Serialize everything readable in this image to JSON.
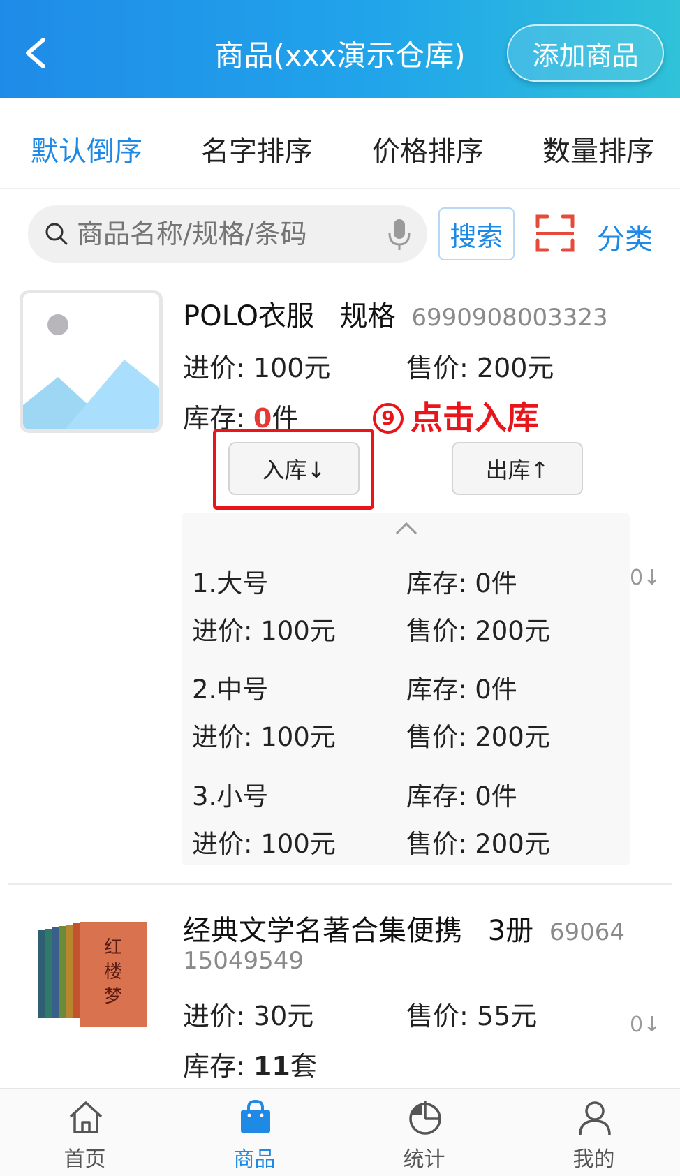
{
  "header": {
    "title": "商品(xxx演示仓库)",
    "add_button": "添加商品"
  },
  "sort_tabs": [
    "默认倒序",
    "名字排序",
    "价格排序",
    "数量排序"
  ],
  "search": {
    "placeholder": "商品名称/规格/条码",
    "button": "搜索",
    "category": "分类"
  },
  "product1": {
    "name": "POLO衣服",
    "spec_label": "规格",
    "barcode": "6990908003323",
    "cost_label": "进价: ",
    "cost": "100元",
    "price_label": "售价: ",
    "price": "200元",
    "stock_label": "库存: ",
    "stock_num": "0",
    "stock_unit": "件",
    "annotation_num": "9",
    "annotation_text": "点击入库",
    "in_button": "入库↓",
    "out_button": "出库↑",
    "specs": [
      {
        "name": "1.大号",
        "stock": "库存: 0件",
        "cost": "进价: 100元",
        "price": "售价: 200元"
      },
      {
        "name": "2.中号",
        "stock": "库存: 0件",
        "cost": "进价: 100元",
        "price": "售价: 200元"
      },
      {
        "name": "3.小号",
        "stock": "库存: 0件",
        "cost": "进价: 100元",
        "price": "售价: 200元"
      }
    ],
    "side_mark": "0↓"
  },
  "product2": {
    "name": "经典文学名著合集便携",
    "spec": "3册",
    "barcode_part1": "69064",
    "barcode_part2": "15049549",
    "cost_label": "进价: ",
    "cost": "30元",
    "price_label": "售价: ",
    "price": "55元",
    "stock_label": "库存: ",
    "stock_num": "11",
    "stock_unit": "套",
    "side_mark": "0↓",
    "book_title_chars": [
      "红",
      "楼",
      "梦"
    ]
  },
  "bottom_nav": [
    {
      "label": "首页",
      "icon": "home-icon"
    },
    {
      "label": "商品",
      "icon": "bag-icon",
      "active": true
    },
    {
      "label": "统计",
      "icon": "pie-chart-icon"
    },
    {
      "label": "我的",
      "icon": "user-icon"
    }
  ],
  "colors": {
    "header_start": "#1f8be8",
    "header_end": "#2fc2d9",
    "accent": "#1e8ae6",
    "annotation": "#e8151a",
    "zero_stock": "#e53935"
  }
}
